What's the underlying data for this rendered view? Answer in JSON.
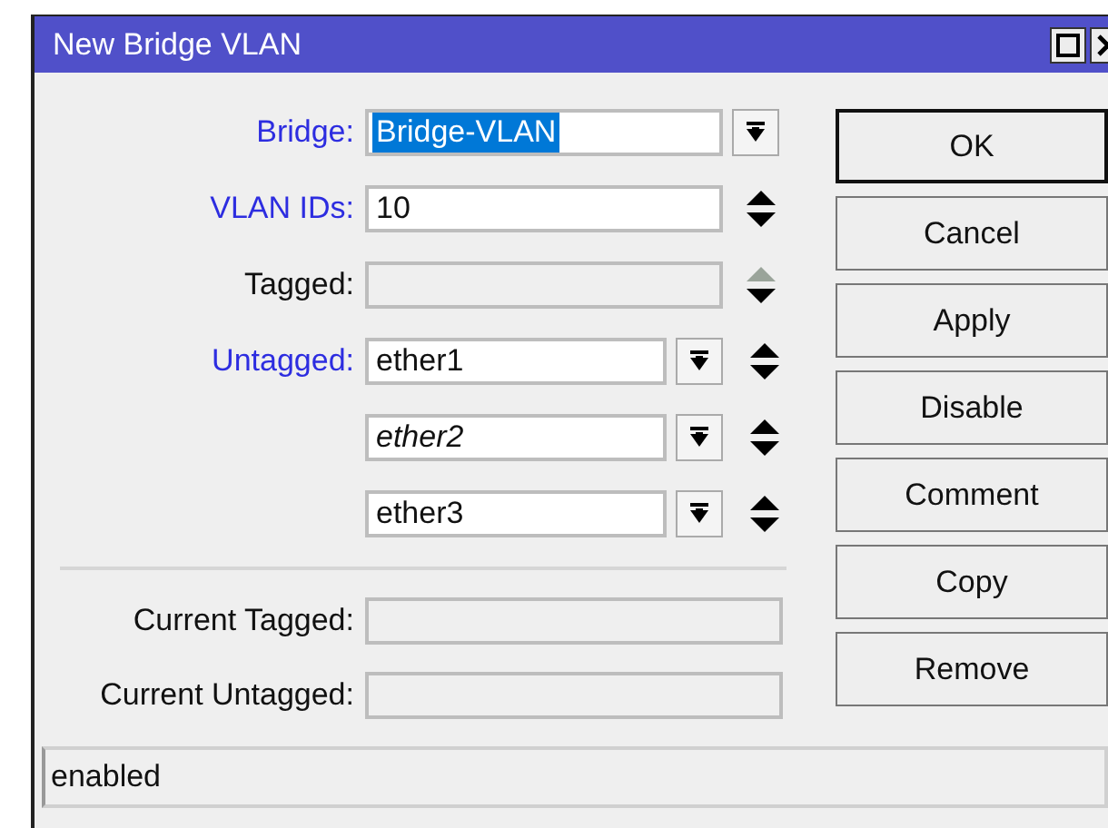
{
  "window": {
    "title": "New Bridge VLAN"
  },
  "fields": [
    {
      "label": "Bridge:",
      "blue": true,
      "kind": "dropdown",
      "value": "Bridge-VLAN",
      "selected": true,
      "italic": false,
      "disabled": false
    },
    {
      "label": "VLAN IDs:",
      "blue": true,
      "kind": "updown",
      "value": "10",
      "selected": false,
      "italic": false,
      "disabled": false
    },
    {
      "label": "Tagged:",
      "blue": false,
      "kind": "updown",
      "disabled": true
    },
    {
      "label": "Untagged:",
      "blue": true,
      "kind": "combo_updown",
      "value": "ether1",
      "selected": false,
      "italic": false,
      "disabled": false
    },
    {
      "kind": "combo_updown",
      "value": "ether2",
      "selected": false,
      "italic": true,
      "disabled": false
    },
    {
      "kind": "combo_updown",
      "value": "ether3",
      "selected": false,
      "italic": false,
      "disabled": false
    }
  ],
  "current": [
    {
      "label": "Current Tagged:"
    },
    {
      "label": "Current Untagged:"
    }
  ],
  "buttons": [
    "OK",
    "Cancel",
    "Apply",
    "Disable",
    "Comment",
    "Copy",
    "Remove"
  ],
  "status_bar": "enabled"
}
